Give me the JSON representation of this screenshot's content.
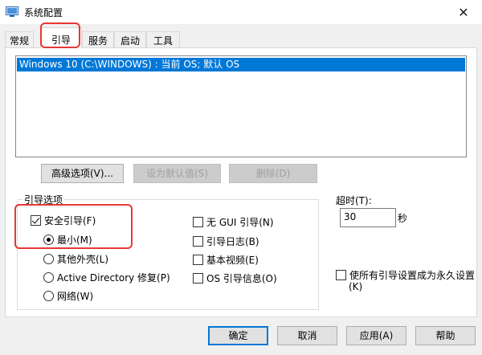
{
  "window": {
    "title": "系统配置",
    "close_glyph": "✕"
  },
  "tabs": [
    {
      "label": "常规"
    },
    {
      "label": "引导"
    },
    {
      "label": "服务"
    },
    {
      "label": "启动"
    },
    {
      "label": "工具"
    }
  ],
  "os_list": {
    "items": [
      "Windows 10 (C:\\WINDOWS) : 当前 OS; 默认 OS"
    ]
  },
  "os_buttons": {
    "advanced": "高级选项(V)...",
    "set_default": "设为默认值(S)",
    "delete": "删除(D)"
  },
  "boot_options": {
    "legend": "引导选项",
    "safe_boot": {
      "label": "安全引导(F)",
      "checked": true
    },
    "radios": [
      {
        "label": "最小(M)",
        "checked": true
      },
      {
        "label": "其他外壳(L)",
        "checked": false
      },
      {
        "label": "Active Directory 修复(P)",
        "checked": false
      },
      {
        "label": "网络(W)",
        "checked": false
      }
    ],
    "right_checks": [
      {
        "label": "无 GUI 引导(N)",
        "checked": false
      },
      {
        "label": "引导日志(B)",
        "checked": false
      },
      {
        "label": "基本视频(E)",
        "checked": false
      },
      {
        "label": "OS 引导信息(O)",
        "checked": false
      }
    ]
  },
  "timeout": {
    "label": "超时(T):",
    "value": "30",
    "unit": "秒"
  },
  "permanent": {
    "label_line1": "使所有引导设置成为永久设置",
    "label_line2": "(K)",
    "checked": false
  },
  "footer": {
    "ok": "确定",
    "cancel": "取消",
    "apply": "应用(A)",
    "help": "帮助"
  }
}
